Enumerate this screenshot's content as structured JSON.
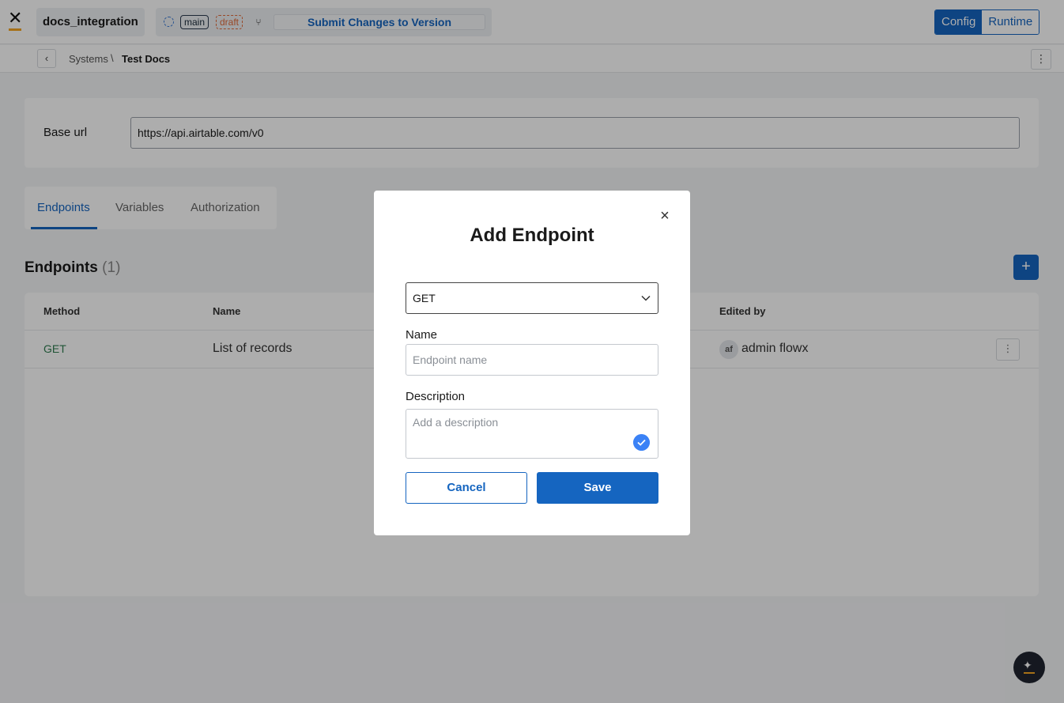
{
  "header": {
    "project_name": "docs_integration",
    "branch": "main",
    "status": "draft",
    "submit_label": "Submit Changes to Version",
    "modes": [
      {
        "label": "Config",
        "active": true
      },
      {
        "label": "Runtime",
        "active": false
      }
    ]
  },
  "breadcrumb": {
    "parent": "Systems",
    "separator": "\\",
    "current": "Test Docs"
  },
  "base_url": {
    "label": "Base url",
    "value": "https://api.airtable.com/v0"
  },
  "tabs": [
    {
      "label": "Endpoints",
      "active": true
    },
    {
      "label": "Variables",
      "active": false
    },
    {
      "label": "Authorization",
      "active": false
    }
  ],
  "endpoints": {
    "title": "Endpoints",
    "count": "(1)",
    "add_label": "+",
    "columns": [
      "Method",
      "Name",
      "Edited by"
    ],
    "rows": [
      {
        "method": "GET",
        "name": "List of records",
        "editor_initials": "af",
        "editor": "admin flowx"
      }
    ]
  },
  "modal": {
    "title": "Add Endpoint",
    "method_value": "GET",
    "name_label": "Name",
    "name_placeholder": "Endpoint name",
    "description_label": "Description",
    "description_placeholder": "Add a description",
    "cancel_label": "Cancel",
    "save_label": "Save"
  },
  "colors": {
    "primary": "#1565c0",
    "method_get": "#2e7d4f",
    "draft": "#e06a3a",
    "accent": "#f5a623"
  }
}
